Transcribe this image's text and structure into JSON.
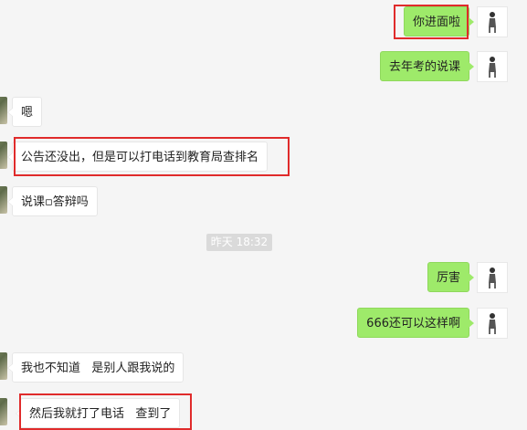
{
  "messages": [
    {
      "side": "right",
      "text": "你进面啦"
    },
    {
      "side": "right",
      "text": "去年考的说课"
    },
    {
      "side": "left",
      "text": "嗯"
    },
    {
      "side": "left",
      "text": "公告还没出，但是可以打电话到教育局查排名"
    },
    {
      "side": "left",
      "text": "说课▫答辩吗"
    },
    {
      "side": "right",
      "text": "厉害"
    },
    {
      "side": "right",
      "text": "666还可以这样啊"
    },
    {
      "side": "left",
      "text": "我也不知道   是别人跟我说的"
    },
    {
      "side": "left",
      "text": "然后我就打了电话   查到了"
    }
  ],
  "timestamp": "昨天 18:32",
  "colors": {
    "sent_bubble": "#9eea6a",
    "received_bubble": "#ffffff",
    "highlight": "#e02b2b",
    "background": "#f5f5f5"
  }
}
